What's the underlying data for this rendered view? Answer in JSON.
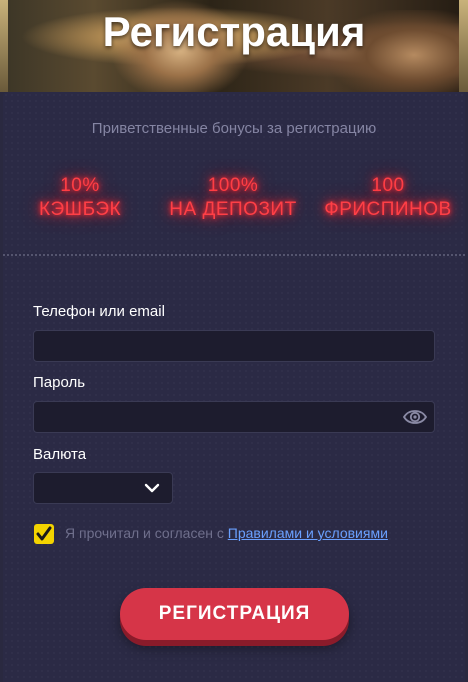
{
  "header": {
    "title": "Регистрация"
  },
  "welcome": {
    "text": "Приветственные бонусы за регистрацию"
  },
  "bonuses": [
    {
      "line1": "10%",
      "line2": "КЭШБЭК"
    },
    {
      "line1": "100%",
      "line2": "НА ДЕПОЗИТ"
    },
    {
      "line1": "100",
      "line2": "ФРИСПИНОВ"
    }
  ],
  "form": {
    "phone_label": "Телефон или email",
    "phone_value": "",
    "password_label": "Пароль",
    "password_value": "",
    "currency_label": "Валюта",
    "currency_value": ""
  },
  "agreement": {
    "checked": true,
    "text": "Я прочитал и согласен с",
    "link": "Правилами и условиями"
  },
  "submit": {
    "label": "РЕГИСТРАЦИЯ"
  },
  "colors": {
    "accent": "#d63548",
    "neon": "#ff3f46",
    "check": "#f3d300",
    "link": "#6aa0ff",
    "panel": "#2b2a45"
  },
  "icons": [
    "eye-icon",
    "chevron-down-icon",
    "checkmark-icon"
  ]
}
